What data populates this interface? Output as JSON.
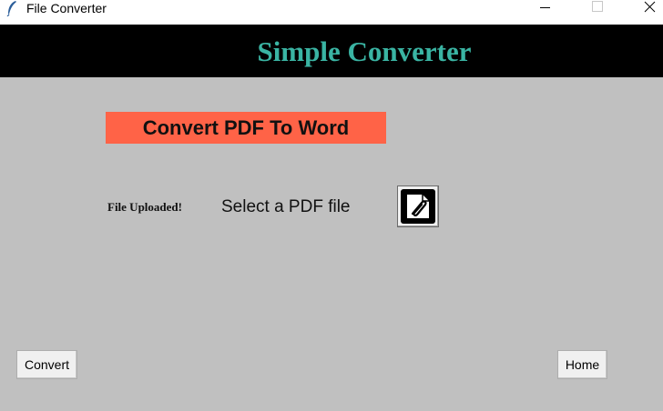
{
  "window": {
    "title": "File Converter",
    "icon": "feather-icon"
  },
  "titlebar_controls": {
    "minimize_icon": "minimize-icon",
    "maximize_icon": "maximize-icon",
    "close_icon": "close-icon"
  },
  "header": {
    "title": "Simple Converter",
    "title_color": "#3ab4a3",
    "background": "#000000"
  },
  "section": {
    "heading": "Convert PDF To Word",
    "heading_background": "#ff6347"
  },
  "upload": {
    "status": "File Uploaded!",
    "select_label": "Select a PDF file",
    "attach_icon": "paperclip-icon"
  },
  "actions": {
    "convert_label": "Convert",
    "home_label": "Home"
  },
  "colors": {
    "window_background": "#c0c0c0"
  }
}
